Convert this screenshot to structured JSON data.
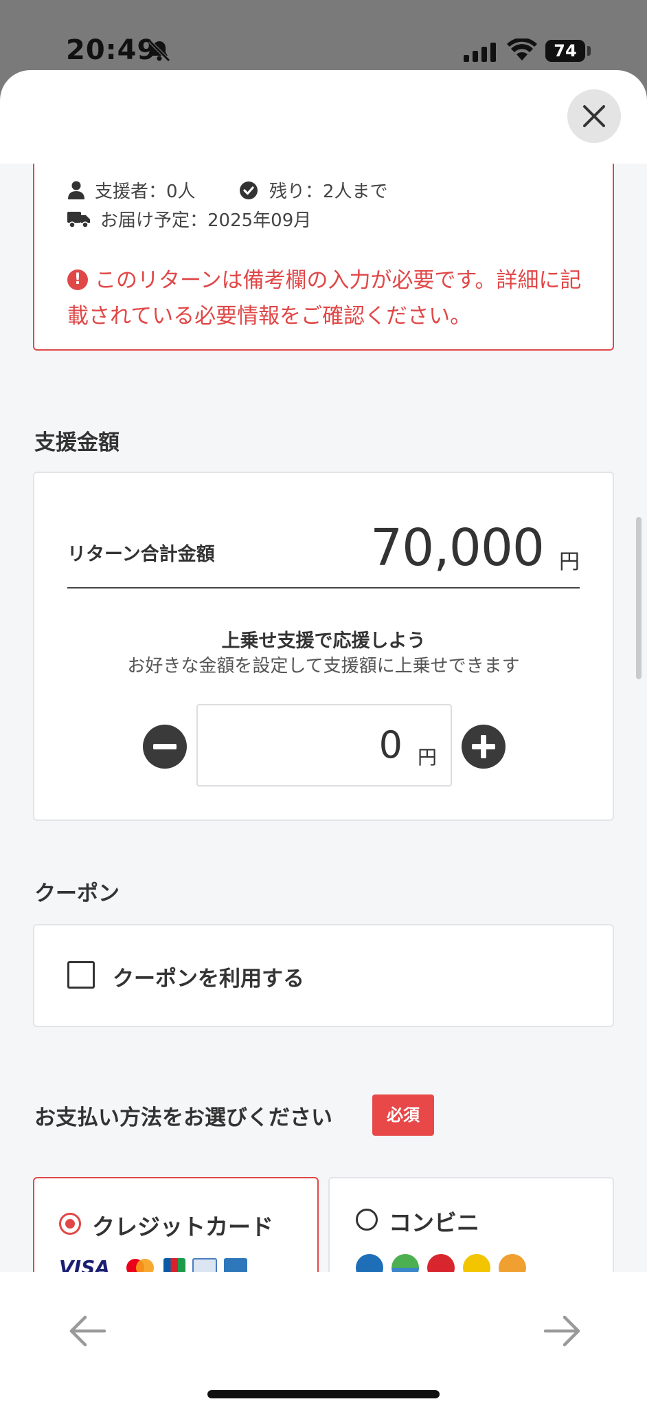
{
  "status_bar": {
    "time": "20:49",
    "battery": "74"
  },
  "reward": {
    "supporters": "支援者：0人",
    "remaining": "残り：2人まで",
    "delivery": "お届け予定：2025年09月",
    "warning": "このリターンは備考欄の入力が必要です。詳細に記載されている必要情報をご確認ください。"
  },
  "amount_section": {
    "title": "支援金額",
    "total_label": "リターン合計金額",
    "total_value": "70,000",
    "currency": "円",
    "extra_title": "上乗せ支援で応援しよう",
    "extra_subtitle": "お好きな金額を設定して支援額に上乗せできます",
    "extra_value": "0"
  },
  "coupon_section": {
    "title": "クーポン",
    "checkbox_label": "クーポンを利用する",
    "checked": false
  },
  "payment_section": {
    "title": "お支払い方法をお選びください",
    "required_badge": "必須",
    "options": [
      {
        "label": "クレジットカード",
        "selected": true
      },
      {
        "label": "コンビニ",
        "selected": false
      }
    ],
    "card_brands": [
      "VISA"
    ]
  },
  "colors": {
    "accent": "#e04848",
    "dark": "#3a3a3a",
    "background": "#f5f6f8"
  }
}
